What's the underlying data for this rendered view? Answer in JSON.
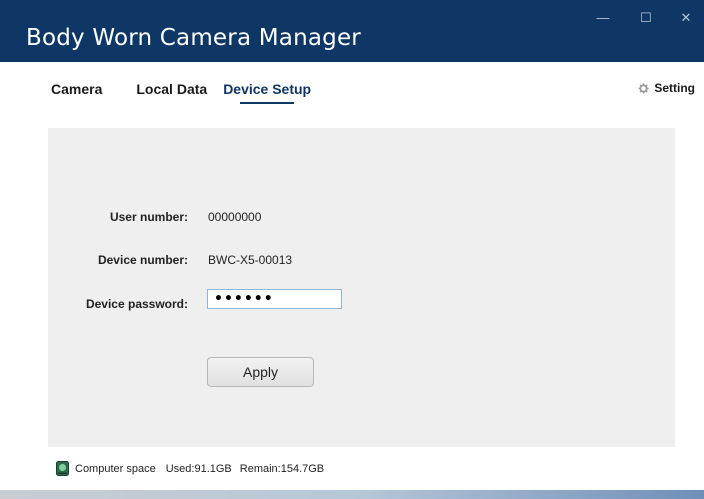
{
  "window": {
    "title": "Body Worn Camera Manager",
    "minimize_glyph": "—",
    "maximize_glyph": "☐",
    "close_glyph": "✕"
  },
  "tabs": [
    {
      "label": "Camera",
      "active": false
    },
    {
      "label": "Local Data",
      "active": false
    },
    {
      "label": "Device Setup",
      "active": true
    }
  ],
  "header": {
    "setting_label": "Setting",
    "setting_icon": "gear-icon"
  },
  "form": {
    "user_number_label": "User number:",
    "user_number_value": "00000000",
    "device_number_label": "Device number:",
    "device_number_value": "BWC-X5-00013",
    "device_password_label": "Device password:",
    "device_password_value": "••••••",
    "apply_label": "Apply"
  },
  "status": {
    "icon": "disk-icon",
    "computer_space_label": "Computer space",
    "used": "Used:91.1GB",
    "remain": "Remain:154.7GB"
  },
  "colors": {
    "titlebar": "#0e3766",
    "panel": "#efefef",
    "active_tab": "#0e3766"
  }
}
